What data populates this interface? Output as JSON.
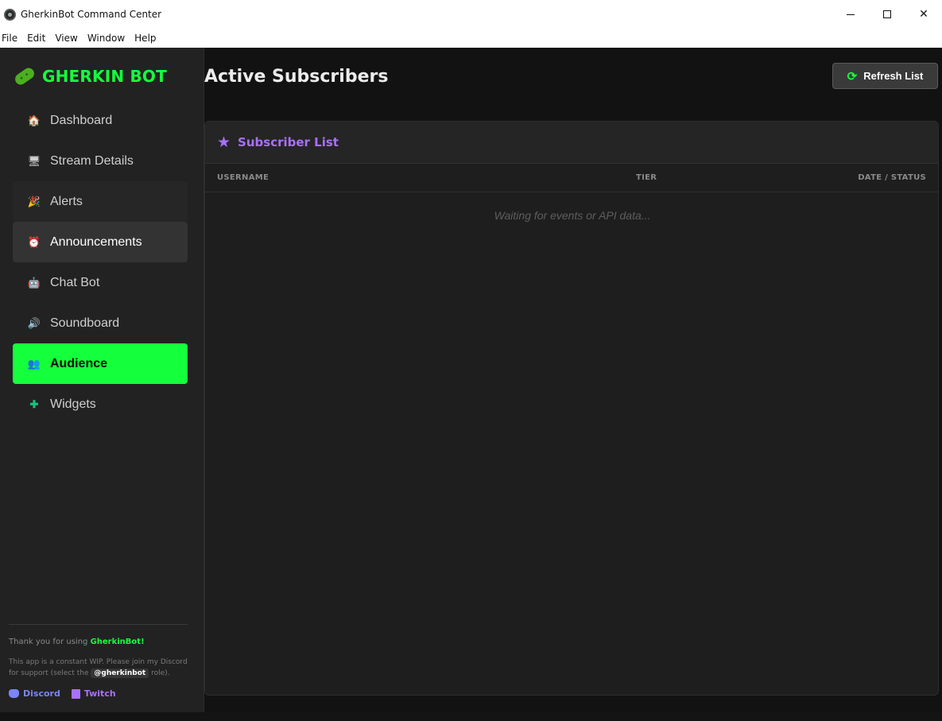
{
  "window": {
    "title": "GherkinBot Command Center",
    "minimize_glyph": "",
    "close_glyph": "✕"
  },
  "menu": [
    "File",
    "Edit",
    "View",
    "Window",
    "Help"
  ],
  "brand": {
    "name": "GHERKIN BOT",
    "icon": "pickle-icon",
    "color": "#14ff3c"
  },
  "nav": [
    {
      "label": "Dashboard",
      "icon": "house-icon",
      "glyph": "🏠"
    },
    {
      "label": "Stream Details",
      "icon": "monitor-icon",
      "glyph": "🖥"
    },
    {
      "label": "Alerts",
      "icon": "party-popper-icon",
      "glyph": "🎉"
    },
    {
      "label": "Announcements",
      "icon": "alarm-clock-icon",
      "glyph": "⏰"
    },
    {
      "label": "Chat Bot",
      "icon": "robot-icon",
      "glyph": "🤖"
    },
    {
      "label": "Soundboard",
      "icon": "speaker-icon",
      "glyph": "🔊"
    },
    {
      "label": "Audience",
      "icon": "users-icon",
      "glyph": "👥"
    },
    {
      "label": "Widgets",
      "icon": "puzzle-icon",
      "glyph": "✚"
    }
  ],
  "nav_state": {
    "active": "Audience",
    "hovered": "Announcements"
  },
  "footer": {
    "thanks_prefix": "Thank you for using ",
    "thanks_name": "GherkinBot!",
    "note_prefix": "This app is a constant WIP. Please join my Discord for support (select the ",
    "note_handle": "@gherkinbot",
    "note_suffix": " role).",
    "links": [
      {
        "label": "Discord",
        "icon": "discord-icon"
      },
      {
        "label": "Twitch",
        "icon": "twitch-icon"
      }
    ]
  },
  "main": {
    "title": "Active Subscribers",
    "refresh_label": "Refresh List",
    "refresh_icon": "refresh-icon",
    "panel": {
      "title": "Subscriber List",
      "icon": "star-icon",
      "columns": [
        "USERNAME",
        "TIER",
        "DATE / STATUS"
      ],
      "empty_message": "Waiting for events or API data..."
    }
  },
  "colors": {
    "accent_green": "#14ff3c",
    "accent_purple": "#a970ff",
    "discord_blue": "#7b84ff",
    "sidebar_bg": "#222222",
    "main_bg": "#121212"
  }
}
